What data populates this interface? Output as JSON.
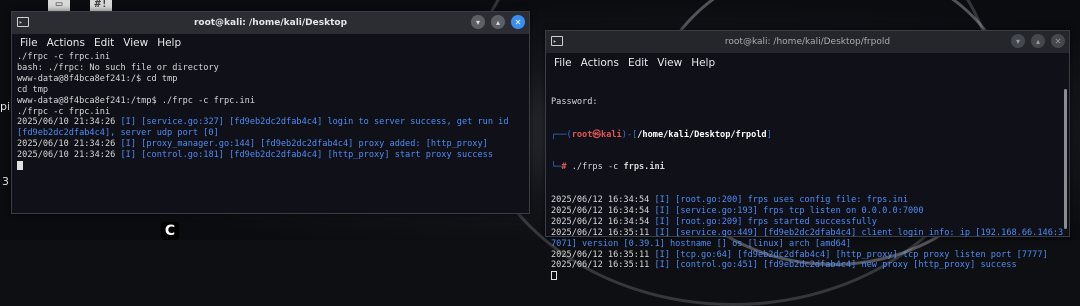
{
  "desktop": {
    "icons": [
      {
        "glyph": "▭",
        "label": ""
      },
      {
        "glyph": "#!",
        "label": ""
      }
    ],
    "side_labels": [
      "pi",
      "3"
    ],
    "dock_glyph": "C"
  },
  "window_left": {
    "title": "root@kali: /home/kali/Desktop",
    "menu": [
      "File",
      "Actions",
      "Edit",
      "View",
      "Help"
    ],
    "lines": [
      {
        "t": "./frpc -c frpc.ini"
      },
      {
        "t": "bash: ./frpc: No such file or directory"
      },
      {
        "t": "www-data@8f4bca8ef241:/$ cd tmp"
      },
      {
        "t": "cd tmp"
      },
      {
        "t": "www-data@8f4bca8ef241:/tmp$ ./frpc -c frpc.ini"
      },
      {
        "t": "./frpc -c frpc.ini"
      },
      {
        "t": "2025/06/10 21:34:26 ",
        "b": "[I] [service.go:327] [fd9eb2dc2dfab4c4] login to server success, get run id [fd9eb2dc2dfab4c4], server udp port [0]"
      },
      {
        "t": "2025/06/10 21:34:26 ",
        "b": "[I] [proxy_manager.go:144] [fd9eb2dc2dfab4c4] proxy added: [http_proxy]"
      },
      {
        "t": "2025/06/10 21:34:26 ",
        "b": "[I] [control.go:181] [fd9eb2dc2dfab4c4] [http_proxy] start proxy success"
      }
    ]
  },
  "window_right": {
    "title": "root@kali: /home/kali/Desktop/frpold",
    "menu": [
      "File",
      "Actions",
      "Edit",
      "View",
      "Help"
    ],
    "password_line": "Password:",
    "prompt": {
      "frame_top": "┌──(",
      "user": "root",
      "at": "㉿",
      "host": "kali",
      "frame_mid": ")-[",
      "path": "/home/kali/Desktop/frpold",
      "frame_end": "]",
      "frame_bottom": "└─",
      "hash": "#",
      "cmd": " ./frps -c ",
      "arg": "frps.ini"
    },
    "lines": [
      {
        "t": "2025/06/12 16:34:54 ",
        "b": "[I] [root.go:200] frps uses config file: frps.ini"
      },
      {
        "t": "2025/06/12 16:34:54 ",
        "b": "[I] [service.go:193] frps tcp listen on 0.0.0.0:7000"
      },
      {
        "t": "2025/06/12 16:34:54 ",
        "b": "[I] [root.go:209] frps started successfully"
      },
      {
        "t": "2025/06/12 16:35:11 ",
        "b": "[I] [service.go:449] [fd9eb2dc2dfab4c4] client login info: ip [192.168.66.146:37071] version [0.39.1] hostname [] os [linux] arch [amd64]"
      },
      {
        "t": "2025/06/12 16:35:11 ",
        "b": "[I] [tcp.go:64] [fd9eb2dc2dfab4c4] [http_proxy] tcp proxy listen port [7777]"
      },
      {
        "t": "2025/06/12 16:35:11 ",
        "b": "[I] [control.go:451] [fd9eb2dc2dfab4c4] new proxy [http_proxy] success"
      }
    ]
  },
  "colors": {
    "log_blue": "#4f8cf5",
    "prompt_red": "#e05656",
    "frame_blue": "#3b6fd8",
    "close_btn": "#3a8ef0"
  }
}
